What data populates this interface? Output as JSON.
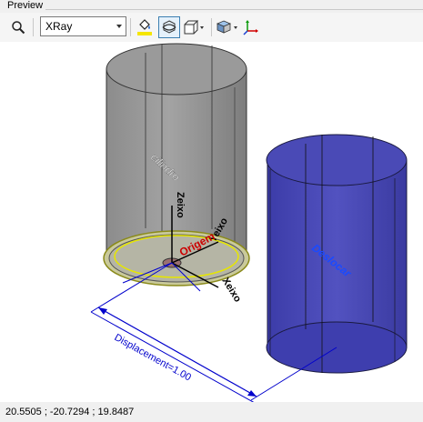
{
  "panel": {
    "title": "Preview"
  },
  "toolbar": {
    "render_mode": "XRay",
    "icons": [
      "search-icon",
      "paint-bucket-icon",
      "rotate-view-icon",
      "box-view-icon",
      "cube-view-icon",
      "axes-icon"
    ]
  },
  "viewport": {
    "labels": {
      "cylinder_left": "cilindro",
      "cylinder_right": "Deslocar",
      "axis_z": "Zeixo",
      "axis_y": "Yeixo",
      "axis_x": "Xeixo",
      "origin": "Origem",
      "displacement": "Displacement=1.00"
    },
    "colors": {
      "left_cylinder": "#8a8a8a",
      "right_cylinder": "#4646a8",
      "dimension": "#0000cc",
      "origin_label": "#cc0000"
    }
  },
  "status": {
    "coordinates": "20.5505 ; -20.7294 ; 19.8487"
  }
}
